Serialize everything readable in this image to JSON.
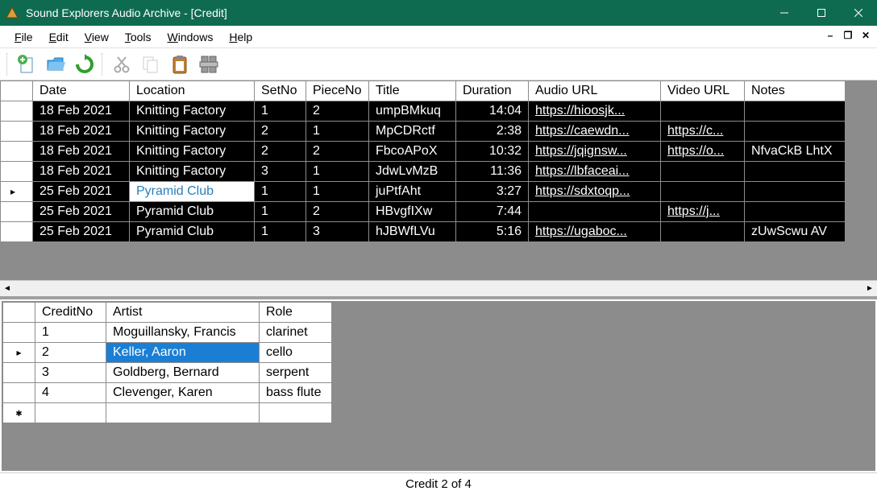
{
  "window_title": "Sound Explorers Audio Archive - [Credit]",
  "menu": [
    "File",
    "Edit",
    "View",
    "Tools",
    "Windows",
    "Help"
  ],
  "toolbar": [
    {
      "name": "new-icon"
    },
    {
      "name": "open-icon"
    },
    {
      "name": "refresh-icon"
    },
    {
      "name": "cut-icon"
    },
    {
      "name": "copy-icon"
    },
    {
      "name": "paste-icon"
    },
    {
      "name": "export-icon"
    }
  ],
  "top_columns": [
    "Date",
    "Location",
    "SetNo",
    "PieceNo",
    "Title",
    "Duration",
    "Audio URL",
    "Video URL",
    "Notes"
  ],
  "top_rows": [
    {
      "date": "18 Feb 2021",
      "loc": "Knitting Factory",
      "setno": "1",
      "pieceno": "2",
      "title": "umpBMkuq",
      "dur": "14:04",
      "audio": "https://hioosjk...",
      "video": "",
      "notes": ""
    },
    {
      "date": "18 Feb 2021",
      "loc": "Knitting Factory",
      "setno": "2",
      "pieceno": "1",
      "title": "MpCDRctf",
      "dur": "2:38",
      "audio": "https://caewdn...",
      "video": "https://c...",
      "notes": ""
    },
    {
      "date": "18 Feb 2021",
      "loc": "Knitting Factory",
      "setno": "2",
      "pieceno": "2",
      "title": "FbcoAPoX",
      "dur": "10:32",
      "audio": "https://jqignsw...",
      "video": "https://o...",
      "notes": "NfvaCkB LhtX"
    },
    {
      "date": "18 Feb 2021",
      "loc": "Knitting Factory",
      "setno": "3",
      "pieceno": "1",
      "title": "JdwLvMzB",
      "dur": "11:36",
      "audio": "https://lbfaceai...",
      "video": "",
      "notes": ""
    },
    {
      "date": "25 Feb 2021",
      "loc": "Pyramid Club",
      "setno": "1",
      "pieceno": "1",
      "title": "juPtfAht",
      "dur": "3:27",
      "audio": "https://sdxtoqp...",
      "video": "",
      "notes": "",
      "selected": true
    },
    {
      "date": "25 Feb 2021",
      "loc": "Pyramid Club",
      "setno": "1",
      "pieceno": "2",
      "title": "HBvgfIXw",
      "dur": "7:44",
      "audio": "",
      "video": "https://j...",
      "notes": ""
    },
    {
      "date": "25 Feb 2021",
      "loc": "Pyramid Club",
      "setno": "1",
      "pieceno": "3",
      "title": "hJBWfLVu",
      "dur": "5:16",
      "audio": "https://ugaboc...",
      "video": "",
      "notes": "zUwScwu AV"
    }
  ],
  "bottom_columns": [
    "CreditNo",
    "Artist",
    "Role"
  ],
  "bottom_rows": [
    {
      "no": "1",
      "artist": "Moguillansky, Francis",
      "role": "clarinet"
    },
    {
      "no": "2",
      "artist": "Keller, Aaron",
      "role": "cello",
      "selected": true
    },
    {
      "no": "3",
      "artist": "Goldberg, Bernard",
      "role": "serpent"
    },
    {
      "no": "4",
      "artist": "Clevenger, Karen",
      "role": "bass flute"
    }
  ],
  "status": "Credit 2 of 4"
}
